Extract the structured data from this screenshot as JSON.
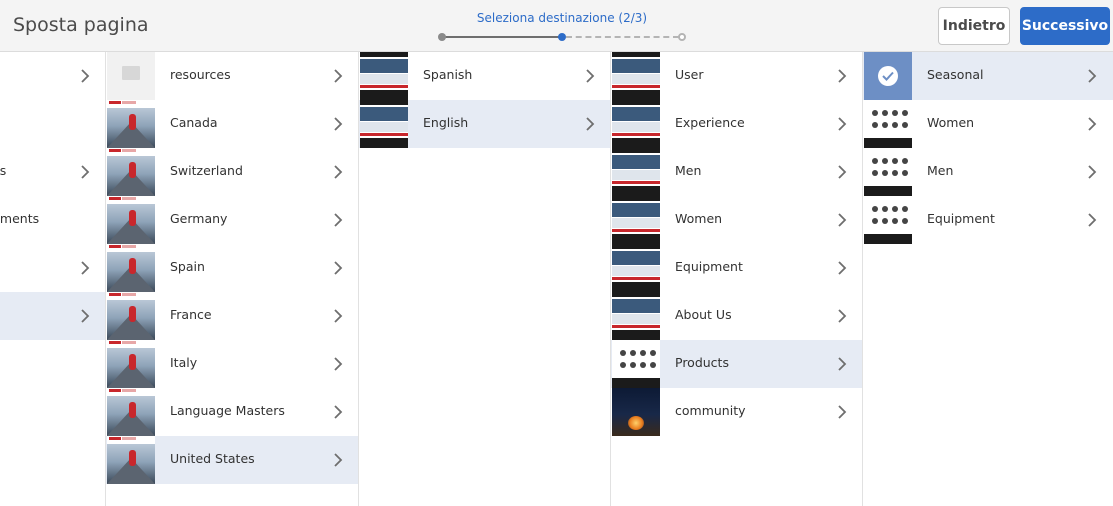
{
  "header": {
    "title": "Sposta pagina",
    "wizard_label": "Seleziona destinazione (2/3)",
    "back_label": "Indietro",
    "next_label": "Successivo",
    "steps": [
      {
        "state": "done"
      },
      {
        "state": "current"
      },
      {
        "state": "todo"
      }
    ],
    "accent_color": "#2d6cc8"
  },
  "columns": [
    {
      "id": "col0",
      "items": [
        {
          "label": "",
          "has_children": true,
          "selected": false
        },
        {
          "label": "",
          "has_children": false,
          "selected": false
        },
        {
          "label": "es",
          "has_children": true,
          "selected": false
        },
        {
          "label": "gments",
          "has_children": false,
          "selected": false
        },
        {
          "label": "",
          "has_children": true,
          "selected": false
        },
        {
          "label": "",
          "has_children": true,
          "selected": true
        }
      ]
    },
    {
      "id": "col1",
      "items": [
        {
          "label": "resources",
          "thumb": "folder",
          "selected": false
        },
        {
          "label": "Canada",
          "thumb": "photo",
          "selected": false
        },
        {
          "label": "Switzerland",
          "thumb": "photo",
          "selected": false
        },
        {
          "label": "Germany",
          "thumb": "photo",
          "selected": false
        },
        {
          "label": "Spain",
          "thumb": "photo",
          "selected": false
        },
        {
          "label": "France",
          "thumb": "photo",
          "selected": false
        },
        {
          "label": "Italy",
          "thumb": "photo",
          "selected": false
        },
        {
          "label": "Language Masters",
          "thumb": "photo",
          "selected": false
        },
        {
          "label": "United States",
          "thumb": "photo",
          "selected": true
        }
      ]
    },
    {
      "id": "col2",
      "items": [
        {
          "label": "Spanish",
          "thumb": "site",
          "selected": false
        },
        {
          "label": "English",
          "thumb": "site",
          "selected": true
        }
      ]
    },
    {
      "id": "col3",
      "items": [
        {
          "label": "User",
          "thumb": "site",
          "selected": false
        },
        {
          "label": "Experience",
          "thumb": "site",
          "selected": false
        },
        {
          "label": "Men",
          "thumb": "site",
          "selected": false
        },
        {
          "label": "Women",
          "thumb": "site",
          "selected": false
        },
        {
          "label": "Equipment",
          "thumb": "site",
          "selected": false
        },
        {
          "label": "About Us",
          "thumb": "site",
          "selected": false
        },
        {
          "label": "Products",
          "thumb": "grid",
          "selected": true
        },
        {
          "label": "community",
          "thumb": "fire",
          "selected": false
        }
      ]
    },
    {
      "id": "col4",
      "items": [
        {
          "label": "Seasonal",
          "thumb": "checked",
          "selected": true
        },
        {
          "label": "Women",
          "thumb": "grid",
          "selected": false
        },
        {
          "label": "Men",
          "thumb": "grid",
          "selected": false
        },
        {
          "label": "Equipment",
          "thumb": "grid",
          "selected": false
        }
      ]
    }
  ]
}
